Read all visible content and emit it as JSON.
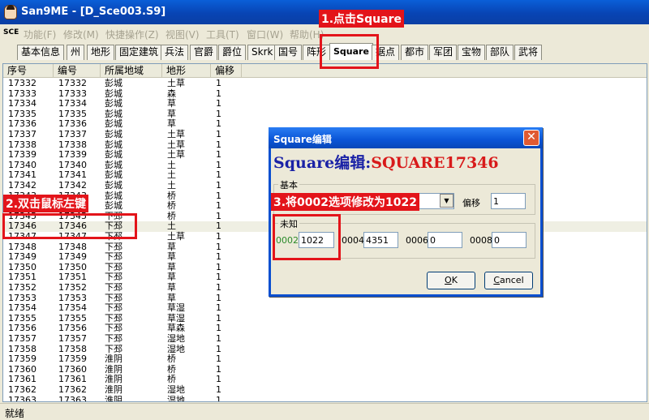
{
  "window": {
    "title": "San9ME - [D_Sce003.S9]"
  },
  "menu": {
    "app_icon": "SCE",
    "items": [
      "功能(F)",
      "修改(M)",
      "快捷操作(Z)",
      "视图(V)",
      "工具(T)",
      "窗口(W)",
      "帮助(H)"
    ]
  },
  "tabs": [
    "基本信息",
    "州",
    "地形",
    "固定建筑",
    "兵法",
    "官爵",
    "爵位",
    "Skrk",
    "国号",
    "阵形",
    "Square",
    "据点",
    "都市",
    "军团",
    "宝物",
    "部队",
    "武将"
  ],
  "active_tab": "Square",
  "list": {
    "columns": [
      "序号",
      "编号",
      "所属地域",
      "地形",
      "偏移"
    ],
    "rows": [
      [
        "17332",
        "17332",
        "彭城",
        "土草",
        "1"
      ],
      [
        "17333",
        "17333",
        "彭城",
        "森",
        "1"
      ],
      [
        "17334",
        "17334",
        "彭城",
        "草",
        "1"
      ],
      [
        "17335",
        "17335",
        "彭城",
        "草",
        "1"
      ],
      [
        "17336",
        "17336",
        "彭城",
        "草",
        "1"
      ],
      [
        "17337",
        "17337",
        "彭城",
        "土草",
        "1"
      ],
      [
        "17338",
        "17338",
        "彭城",
        "土草",
        "1"
      ],
      [
        "17339",
        "17339",
        "彭城",
        "土草",
        "1"
      ],
      [
        "17340",
        "17340",
        "彭城",
        "土",
        "1"
      ],
      [
        "17341",
        "17341",
        "彭城",
        "土",
        "1"
      ],
      [
        "17342",
        "17342",
        "彭城",
        "土",
        "1"
      ],
      [
        "17343",
        "17343",
        "彭城",
        "桥",
        "1"
      ],
      [
        "17344",
        "17344",
        "彭城",
        "桥",
        "1"
      ],
      [
        "17345",
        "17345",
        "下邳",
        "桥",
        "1"
      ],
      [
        "17346",
        "17346",
        "下邳",
        "土",
        "1"
      ],
      [
        "17347",
        "17347",
        "下邳",
        "土草",
        "1"
      ],
      [
        "17348",
        "17348",
        "下邳",
        "草",
        "1"
      ],
      [
        "17349",
        "17349",
        "下邳",
        "草",
        "1"
      ],
      [
        "17350",
        "17350",
        "下邳",
        "草",
        "1"
      ],
      [
        "17351",
        "17351",
        "下邳",
        "草",
        "1"
      ],
      [
        "17352",
        "17352",
        "下邳",
        "草",
        "1"
      ],
      [
        "17353",
        "17353",
        "下邳",
        "草",
        "1"
      ],
      [
        "17354",
        "17354",
        "下邳",
        "草湿",
        "1"
      ],
      [
        "17355",
        "17355",
        "下邳",
        "草湿",
        "1"
      ],
      [
        "17356",
        "17356",
        "下邳",
        "草森",
        "1"
      ],
      [
        "17357",
        "17357",
        "下邳",
        "湿地",
        "1"
      ],
      [
        "17358",
        "17358",
        "下邳",
        "湿地",
        "1"
      ],
      [
        "17359",
        "17359",
        "淮阴",
        "桥",
        "1"
      ],
      [
        "17360",
        "17360",
        "淮阴",
        "桥",
        "1"
      ],
      [
        "17361",
        "17361",
        "淮阴",
        "桥",
        "1"
      ],
      [
        "17362",
        "17362",
        "淮阴",
        "湿地",
        "1"
      ],
      [
        "17363",
        "17363",
        "淮阴",
        "湿地",
        "1"
      ]
    ],
    "selected_index": 14
  },
  "dialog": {
    "title": "Square编辑",
    "heading_label": "Square编辑:",
    "heading_value": "SQUARE17346",
    "basic_group": "基本",
    "offset_label": "偏移",
    "offset_value": "1",
    "unknown_group": "未知",
    "fields": [
      {
        "label": "0002",
        "value": "1022"
      },
      {
        "label": "0004",
        "value": "4351"
      },
      {
        "label": "0006",
        "value": "0"
      },
      {
        "label": "0008",
        "value": "0"
      }
    ],
    "ok_mnemonic": "O",
    "ok_rest": "K",
    "cancel_mnemonic": "C",
    "cancel_rest": "ancel",
    "close_glyph": "✕"
  },
  "status": "就绪",
  "annotations": {
    "step1": "1.点击Square",
    "step2": "2.双击鼠标左键",
    "step3": "3.将0002选项修改为1022"
  },
  "colors": {
    "annotation": "#e3141a",
    "field_label_highlight": "#2a8a2a",
    "heading_value": "#d81a1a",
    "heading_label": "#1a22a6"
  }
}
